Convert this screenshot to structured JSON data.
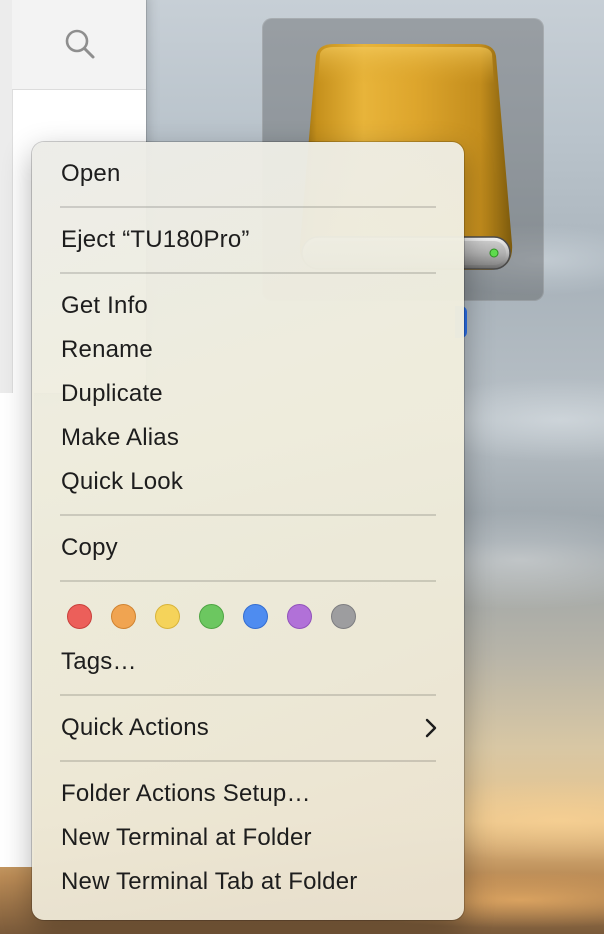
{
  "context_menu": {
    "open": "Open",
    "eject": "Eject “TU180Pro”",
    "get_info": "Get Info",
    "rename": "Rename",
    "duplicate": "Duplicate",
    "make_alias": "Make Alias",
    "quick_look": "Quick Look",
    "copy": "Copy",
    "tags": "Tags…",
    "quick_actions": "Quick Actions",
    "folder_actions_setup": "Folder Actions Setup…",
    "new_terminal_at_folder": "New Terminal at Folder",
    "new_terminal_tab_at_folder": "New Terminal Tab at Folder"
  },
  "tag_colors": [
    {
      "name": "red",
      "fill": "#ec5f5a",
      "stroke": "#c9403b"
    },
    {
      "name": "orange",
      "fill": "#f0a451",
      "stroke": "#d08330"
    },
    {
      "name": "yellow",
      "fill": "#f5d35a",
      "stroke": "#d8b43a"
    },
    {
      "name": "green",
      "fill": "#6cc760",
      "stroke": "#4ea543"
    },
    {
      "name": "blue",
      "fill": "#4e8cf0",
      "stroke": "#336dd0"
    },
    {
      "name": "purple",
      "fill": "#b171d8",
      "stroke": "#9152bb"
    },
    {
      "name": "gray",
      "fill": "#9d9d9f",
      "stroke": "#7d7d80"
    }
  ],
  "icons": {
    "finder_search": "search-icon",
    "drive": "external-drive-icon",
    "submenu": "chevron-right-icon"
  }
}
